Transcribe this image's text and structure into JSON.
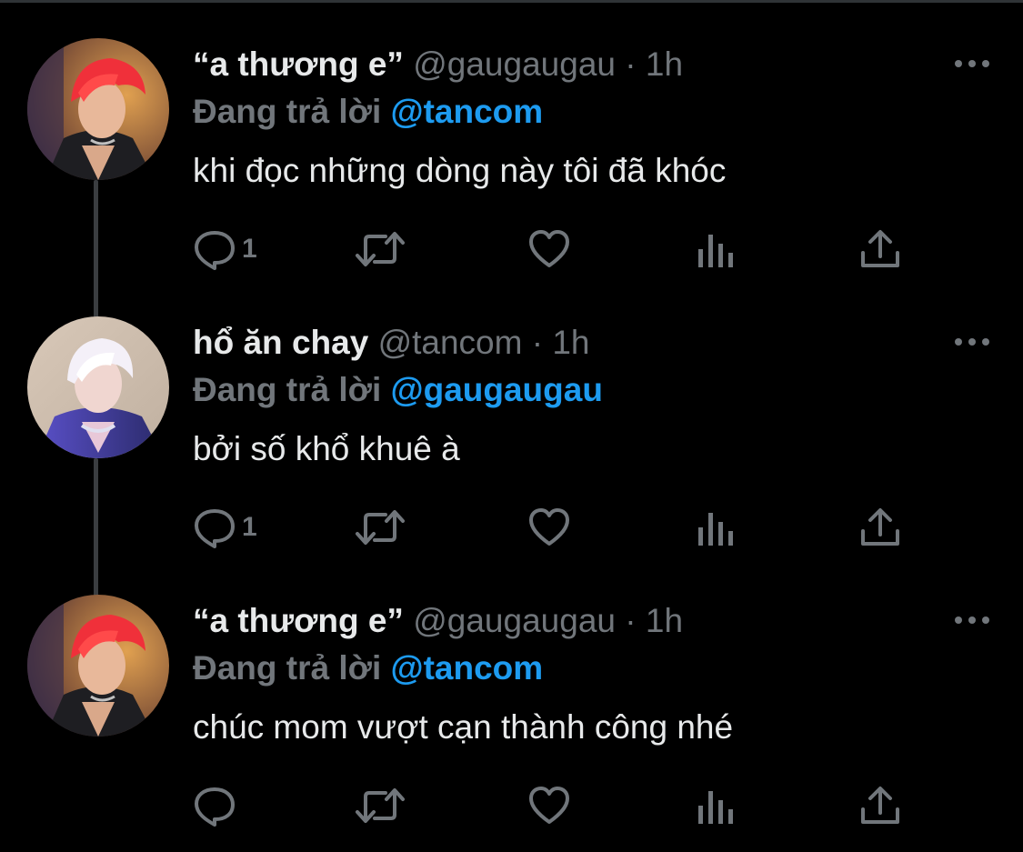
{
  "colors": {
    "background": "#000000",
    "text_primary": "#e7e9ea",
    "text_secondary": "#71767b",
    "accent": "#1d9bf0",
    "thread_line": "#3a3d40"
  },
  "tweets": [
    {
      "display_name": "“a thương e”",
      "handle": "@gaugaugau",
      "separator": "·",
      "time": "1h",
      "reply_prefix": "Đang trả lời",
      "reply_to": "@tancom",
      "text": "khi đọc những dòng này tôi đã khóc",
      "reply_count": "1",
      "icons": [
        "reply-icon",
        "retweet-icon",
        "like-icon",
        "analytics-icon",
        "share-icon",
        "more-icon"
      ]
    },
    {
      "display_name": "hổ ăn chay",
      "handle": "@tancom",
      "separator": "·",
      "time": "1h",
      "reply_prefix": "Đang trả lời",
      "reply_to": "@gaugaugau",
      "text": "bởi số khổ khuê à",
      "reply_count": "1",
      "icons": [
        "reply-icon",
        "retweet-icon",
        "like-icon",
        "analytics-icon",
        "share-icon",
        "more-icon"
      ]
    },
    {
      "display_name": "“a thương e”",
      "handle": "@gaugaugau",
      "separator": "·",
      "time": "1h",
      "reply_prefix": "Đang trả lời",
      "reply_to": "@tancom",
      "text": "chúc mom vượt cạn thành công nhé",
      "reply_count": "",
      "icons": [
        "reply-icon",
        "retweet-icon",
        "like-icon",
        "analytics-icon",
        "share-icon",
        "more-icon"
      ]
    }
  ]
}
